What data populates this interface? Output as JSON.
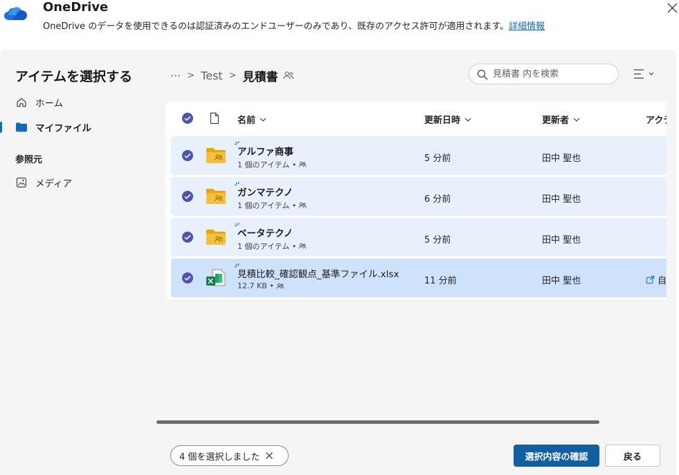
{
  "header": {
    "app_title": "OneDrive",
    "notice_text": "OneDrive のデータを使用できるのは認証済みのエンドユーザーのみであり、既存のアクセス許可が適用されます。",
    "notice_link": "詳細情報"
  },
  "nav": {
    "title": "アイテムを選択する",
    "items": [
      {
        "label": "ホーム",
        "icon": "home-icon"
      },
      {
        "label": "マイファイル",
        "icon": "folder-icon",
        "selected": true
      }
    ],
    "section_label": "参照元",
    "section_items": [
      {
        "label": "メディア",
        "icon": "image-icon"
      }
    ]
  },
  "breadcrumb": {
    "ellipsis": "···",
    "items": [
      "Test"
    ],
    "current": "見積書"
  },
  "search": {
    "placeholder": "見積書 内を検索"
  },
  "table": {
    "columns": {
      "name": "名前",
      "modified": "更新日時",
      "modified_by": "更新者",
      "activity": "アクティビティ"
    },
    "rows": [
      {
        "name": "アルファ商事",
        "meta": "1 個のアイテム •",
        "modified": "5 分前",
        "modified_by": "田中 聖也",
        "type": "folder",
        "selected": true
      },
      {
        "name": "ガンマテクノ",
        "meta": "1 個のアイテム •",
        "modified": "6 分前",
        "modified_by": "田中 聖也",
        "type": "folder",
        "selected": true
      },
      {
        "name": "ベータテクノ",
        "meta": "1 個のアイテム •",
        "modified": "5 分前",
        "modified_by": "田中 聖也",
        "type": "folder",
        "selected": true
      },
      {
        "name": "見積比較_確認観点_基準ファイル.xlsx",
        "meta": "12.7 KB •",
        "modified": "11 分前",
        "modified_by": "田中 聖也",
        "type": "excel",
        "selected": true,
        "activity": "自"
      }
    ]
  },
  "footer": {
    "selection_text": "4 個を選択しました",
    "confirm_button": "選択内容の確認",
    "back_button": "戻る"
  },
  "colors": {
    "accent": "#0f6cbd",
    "primary_button": "#115ea3",
    "row_selected": "#e8f0fb",
    "row_highlight": "#cfe2fb",
    "folder": "#f5c13d"
  }
}
